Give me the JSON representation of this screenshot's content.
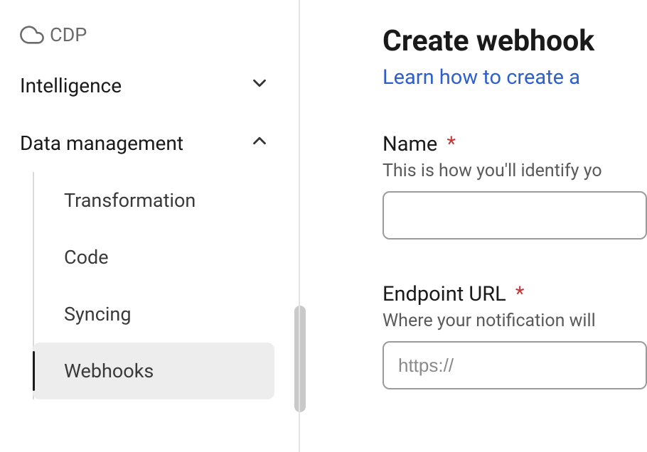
{
  "sidebar": {
    "cdp": {
      "label": "CDP"
    },
    "intelligence": {
      "label": "Intelligence"
    },
    "data_management": {
      "label": "Data management",
      "items": [
        {
          "label": "Transformation"
        },
        {
          "label": "Code"
        },
        {
          "label": "Syncing"
        },
        {
          "label": "Webhooks"
        }
      ]
    }
  },
  "main": {
    "title": "Create webhook",
    "help_link": "Learn how to create a",
    "fields": {
      "name": {
        "label": "Name",
        "required_mark": "*",
        "help": "This is how you'll identify yo"
      },
      "endpoint_url": {
        "label": "Endpoint URL",
        "required_mark": "*",
        "help": "Where your notification will",
        "placeholder": "https://"
      }
    }
  }
}
